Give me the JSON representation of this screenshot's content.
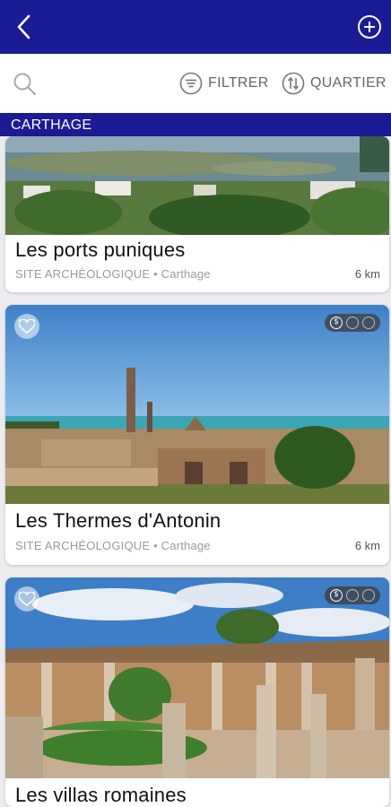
{
  "header": {
    "back_icon": "chevron-left-icon",
    "add_icon": "plus-circle-icon"
  },
  "toolbar": {
    "search_icon": "search-icon",
    "filter_label": "FILTRER",
    "quartier_label": "QUARTIER"
  },
  "section": {
    "title": "CARTHAGE"
  },
  "cards": [
    {
      "title": "Les ports puniques",
      "category": "SITE ARCHÉOLOGIQUE",
      "location": "Carthage",
      "separator": "•",
      "distance": "6 km"
    },
    {
      "title": "Les Thermes d'Antonin",
      "category": "SITE ARCHÉOLOGIQUE",
      "location": "Carthage",
      "separator": "•",
      "distance": "6 km",
      "price_symbol": "$",
      "price_level": 1,
      "price_max": 3
    },
    {
      "title": "Les villas romaines",
      "price_symbol": "$",
      "price_level": 1,
      "price_max": 3
    }
  ],
  "colors": {
    "brand": "#1b1b96",
    "meta": "#9a9a9a"
  }
}
